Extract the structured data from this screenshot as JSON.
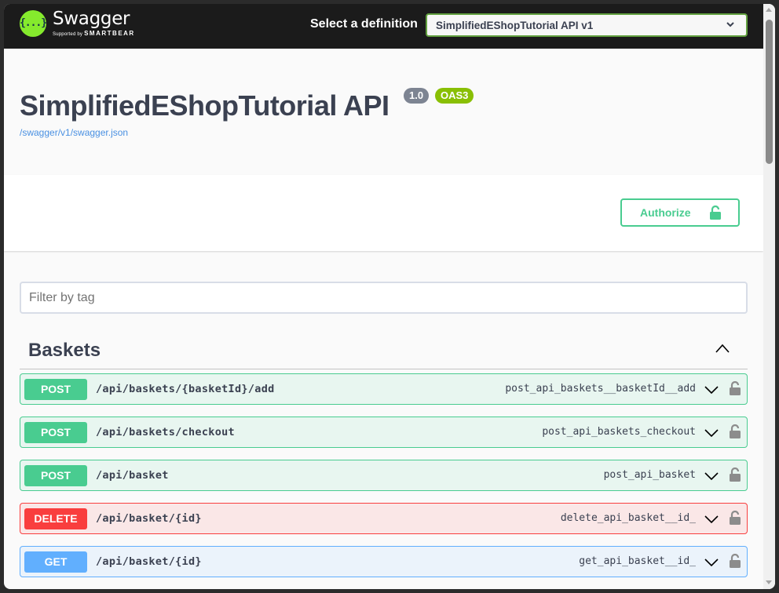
{
  "topbar": {
    "logo_name": "Swagger",
    "logo_sub_prefix": "Supported by",
    "logo_sub_brand": "SMARTBEAR",
    "logo_glyph": "{...}",
    "definition_label": "Select a definition",
    "definition_selected": "SimplifiedEShopTutorial API v1"
  },
  "info": {
    "title": "SimplifiedEShopTutorial API",
    "version_badge": "1.0",
    "oas_badge": "OAS3",
    "spec_url": "/swagger/v1/swagger.json"
  },
  "auth": {
    "authorize_label": "Authorize"
  },
  "filter": {
    "placeholder": "Filter by tag",
    "value": ""
  },
  "colors": {
    "post": "#49cc90",
    "delete": "#f93e3e",
    "get": "#61affe",
    "accent": "#85ea2d"
  },
  "tags": [
    {
      "name": "Baskets",
      "expanded": true,
      "operations": [
        {
          "method": "POST",
          "path": "/api/baskets/{basketId}/add",
          "operation_id": "post_api_baskets__basketId__add",
          "locked": false
        },
        {
          "method": "POST",
          "path": "/api/baskets/checkout",
          "operation_id": "post_api_baskets_checkout",
          "locked": false
        },
        {
          "method": "POST",
          "path": "/api/basket",
          "operation_id": "post_api_basket",
          "locked": false
        },
        {
          "method": "DELETE",
          "path": "/api/basket/{id}",
          "operation_id": "delete_api_basket__id_",
          "locked": false
        },
        {
          "method": "GET",
          "path": "/api/basket/{id}",
          "operation_id": "get_api_basket__id_",
          "locked": false
        }
      ]
    }
  ]
}
